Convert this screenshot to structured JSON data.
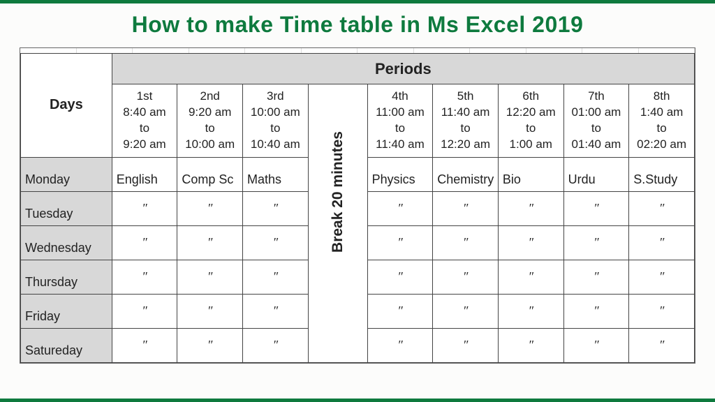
{
  "title": "How to make Time table in Ms Excel 2019",
  "heads": {
    "days": "Days",
    "periods": "Periods",
    "break": "Break 20 minutes"
  },
  "periods": [
    {
      "num": "1st",
      "from": "8:40 am",
      "to": "9:20 am"
    },
    {
      "num": "2nd",
      "from": "9:20 am",
      "to": "10:00 am"
    },
    {
      "num": "3rd",
      "from": "10:00 am",
      "to": "10:40 am"
    },
    {
      "num": "4th",
      "from": "11:00 am",
      "to": "11:40 am"
    },
    {
      "num": "5th",
      "from": "11:40 am",
      "to": "12:20 am"
    },
    {
      "num": "6th",
      "from": "12:20 am",
      "to": "1:00 am"
    },
    {
      "num": "7th",
      "from": "01:00 am",
      "to": "01:40 am"
    },
    {
      "num": "8th",
      "from": "1:40 am",
      "to": "02:20 am"
    }
  ],
  "days": [
    "Monday",
    "Tuesday",
    "Wednesday",
    "Thursday",
    "Friday",
    "Satureday"
  ],
  "subjects": [
    "English",
    "Comp Sc",
    "Maths",
    "Physics",
    "Chemistry",
    "Bio",
    "Urdu",
    "S.Study"
  ],
  "ditto": "″",
  "to_word": "to",
  "chart_data": {
    "type": "table",
    "title": "School Timetable",
    "columns": [
      "Day",
      "1st 8:40-9:20",
      "2nd 9:20-10:00",
      "3rd 10:00-10:40",
      "Break 20 min",
      "4th 11:00-11:40",
      "5th 11:40-12:20",
      "6th 12:20-1:00",
      "7th 01:00-01:40",
      "8th 1:40-02:20"
    ],
    "rows": [
      [
        "Monday",
        "English",
        "Comp Sc",
        "Maths",
        "Break",
        "Physics",
        "Chemistry",
        "Bio",
        "Urdu",
        "S.Study"
      ],
      [
        "Tuesday",
        "English",
        "Comp Sc",
        "Maths",
        "Break",
        "Physics",
        "Chemistry",
        "Bio",
        "Urdu",
        "S.Study"
      ],
      [
        "Wednesday",
        "English",
        "Comp Sc",
        "Maths",
        "Break",
        "Physics",
        "Chemistry",
        "Bio",
        "Urdu",
        "S.Study"
      ],
      [
        "Thursday",
        "English",
        "Comp Sc",
        "Maths",
        "Break",
        "Physics",
        "Chemistry",
        "Bio",
        "Urdu",
        "S.Study"
      ],
      [
        "Friday",
        "English",
        "Comp Sc",
        "Maths",
        "Break",
        "Physics",
        "Chemistry",
        "Bio",
        "Urdu",
        "S.Study"
      ],
      [
        "Satureday",
        "English",
        "Comp Sc",
        "Maths",
        "Break",
        "Physics",
        "Chemistry",
        "Bio",
        "Urdu",
        "S.Study"
      ]
    ]
  }
}
